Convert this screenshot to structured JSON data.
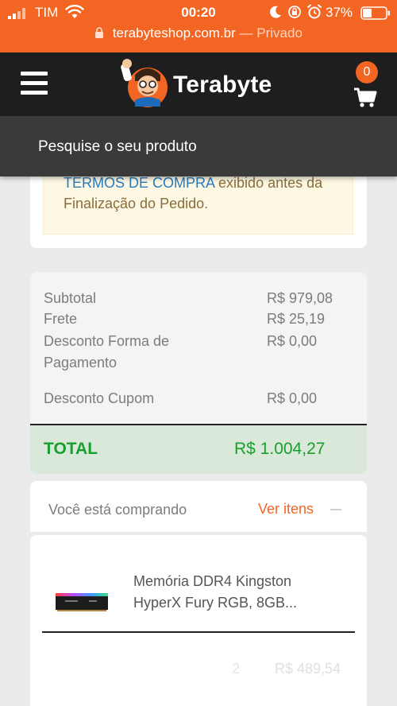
{
  "status_bar": {
    "carrier": "TIM",
    "time": "00:20",
    "battery": "37%"
  },
  "browser": {
    "domain": "terabyteshop.com.br",
    "mode": "— Privado"
  },
  "header": {
    "logo_text": "Terabyte",
    "cart_count": "0"
  },
  "search": {
    "placeholder": "Pesquise o seu produto"
  },
  "terms": {
    "link_text": "TERMOS DE COMPRA",
    "rest_text": " exibido antes da Finalização do Pedido."
  },
  "summary": {
    "subtotal_label": "Subtotal",
    "subtotal_value": "R$ 979,08",
    "shipping_label": "Frete",
    "shipping_value": "R$ 25,19",
    "payment_discount_label": "Desconto Forma de Pagamento",
    "payment_discount_value": "R$ 0,00",
    "coupon_discount_label": "Desconto Cupom",
    "coupon_discount_value": "R$ 0,00",
    "total_label": "TOTAL",
    "total_value": "R$ 1.004,27"
  },
  "buying": {
    "label": "Você está comprando",
    "view_items": "Ver itens"
  },
  "product": {
    "name": "Memória DDR4 Kingston HyperX Fury RGB, 8GB...",
    "quantity": "2",
    "price": "R$ 489,54"
  },
  "colors": {
    "brand_orange": "#f26522",
    "header_dark": "#1e1e1e",
    "total_green": "#17a02e",
    "link_blue": "#2a7bbf"
  }
}
